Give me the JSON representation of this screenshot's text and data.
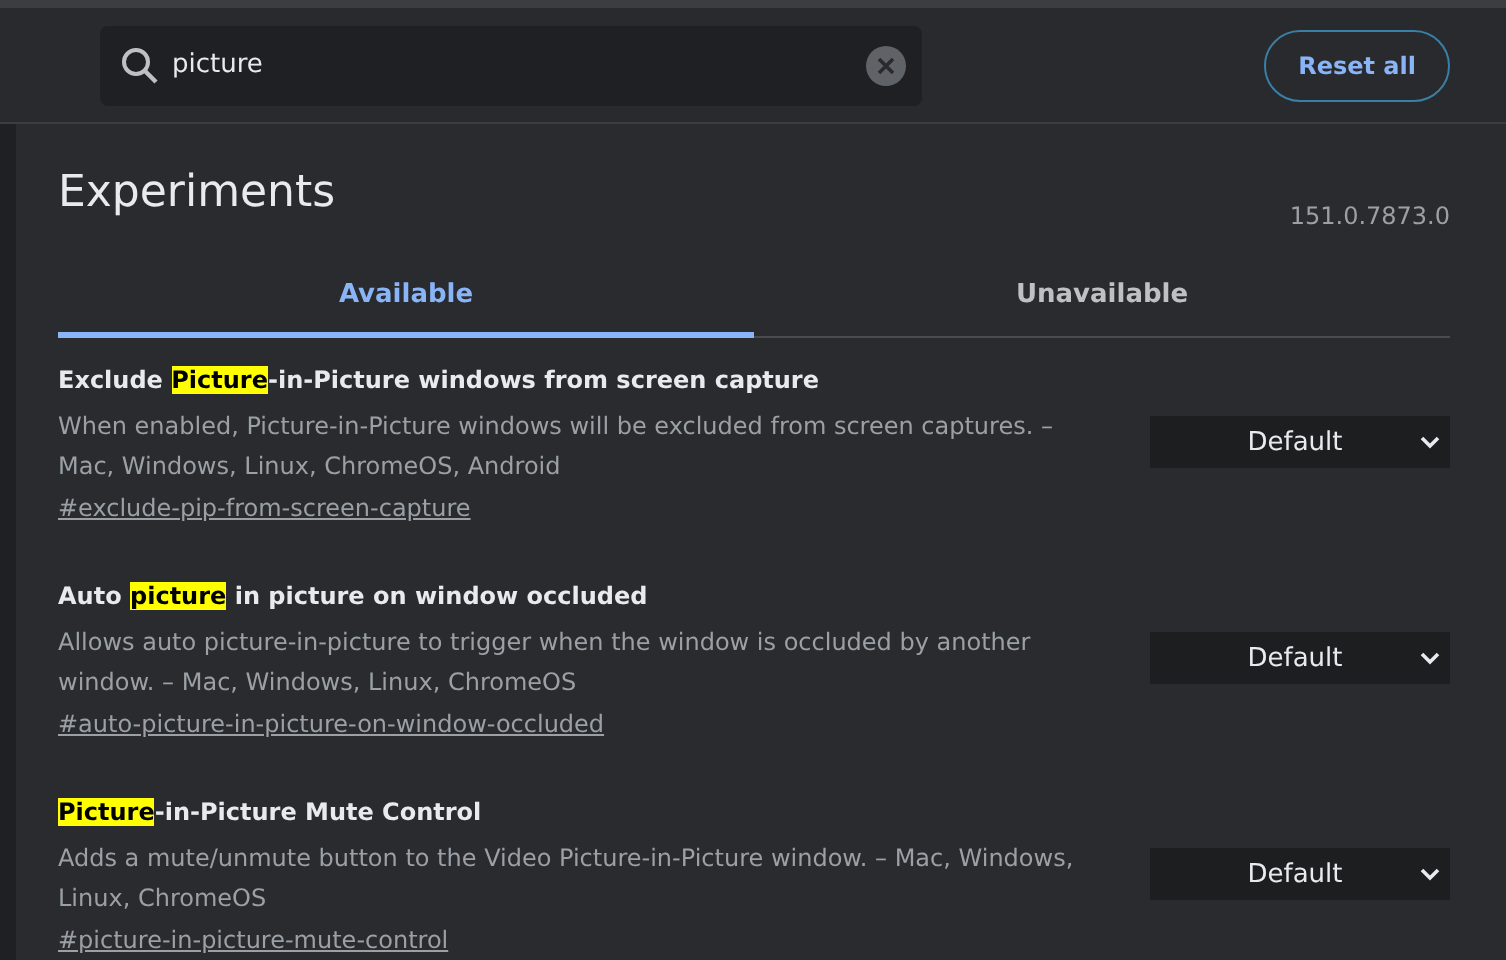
{
  "search": {
    "value": "picture"
  },
  "reset_button": "Reset all",
  "title": "Experiments",
  "version": "151.0.7873.0",
  "tabs": [
    {
      "label": "Available",
      "selected": true
    },
    {
      "label": "Unavailable",
      "selected": false
    }
  ],
  "experiments": [
    {
      "title_before": "Exclude ",
      "title_match": "Picture",
      "title_after": "-in-Picture windows from screen capture",
      "description": "When enabled, Picture-in-Picture windows will be excluded from screen captures. – Mac, Windows, Linux, ChromeOS, Android",
      "link": "#exclude-pip-from-screen-capture",
      "value": "Default"
    },
    {
      "title_before": "Auto ",
      "title_match": "picture",
      "title_after": " in picture on window occluded",
      "description": "Allows auto picture-in-picture to trigger when the window is occluded by another window. – Mac, Windows, Linux, ChromeOS",
      "link": "#auto-picture-in-picture-on-window-occluded",
      "value": "Default"
    },
    {
      "title_match": "Picture",
      "title_after": "-in-Picture Mute Control",
      "description": "Adds a mute/unmute button to the Video Picture-in-Picture window. – Mac, Windows, Linux, ChromeOS",
      "link": "#picture-in-picture-mute-control",
      "value": "Default"
    }
  ]
}
